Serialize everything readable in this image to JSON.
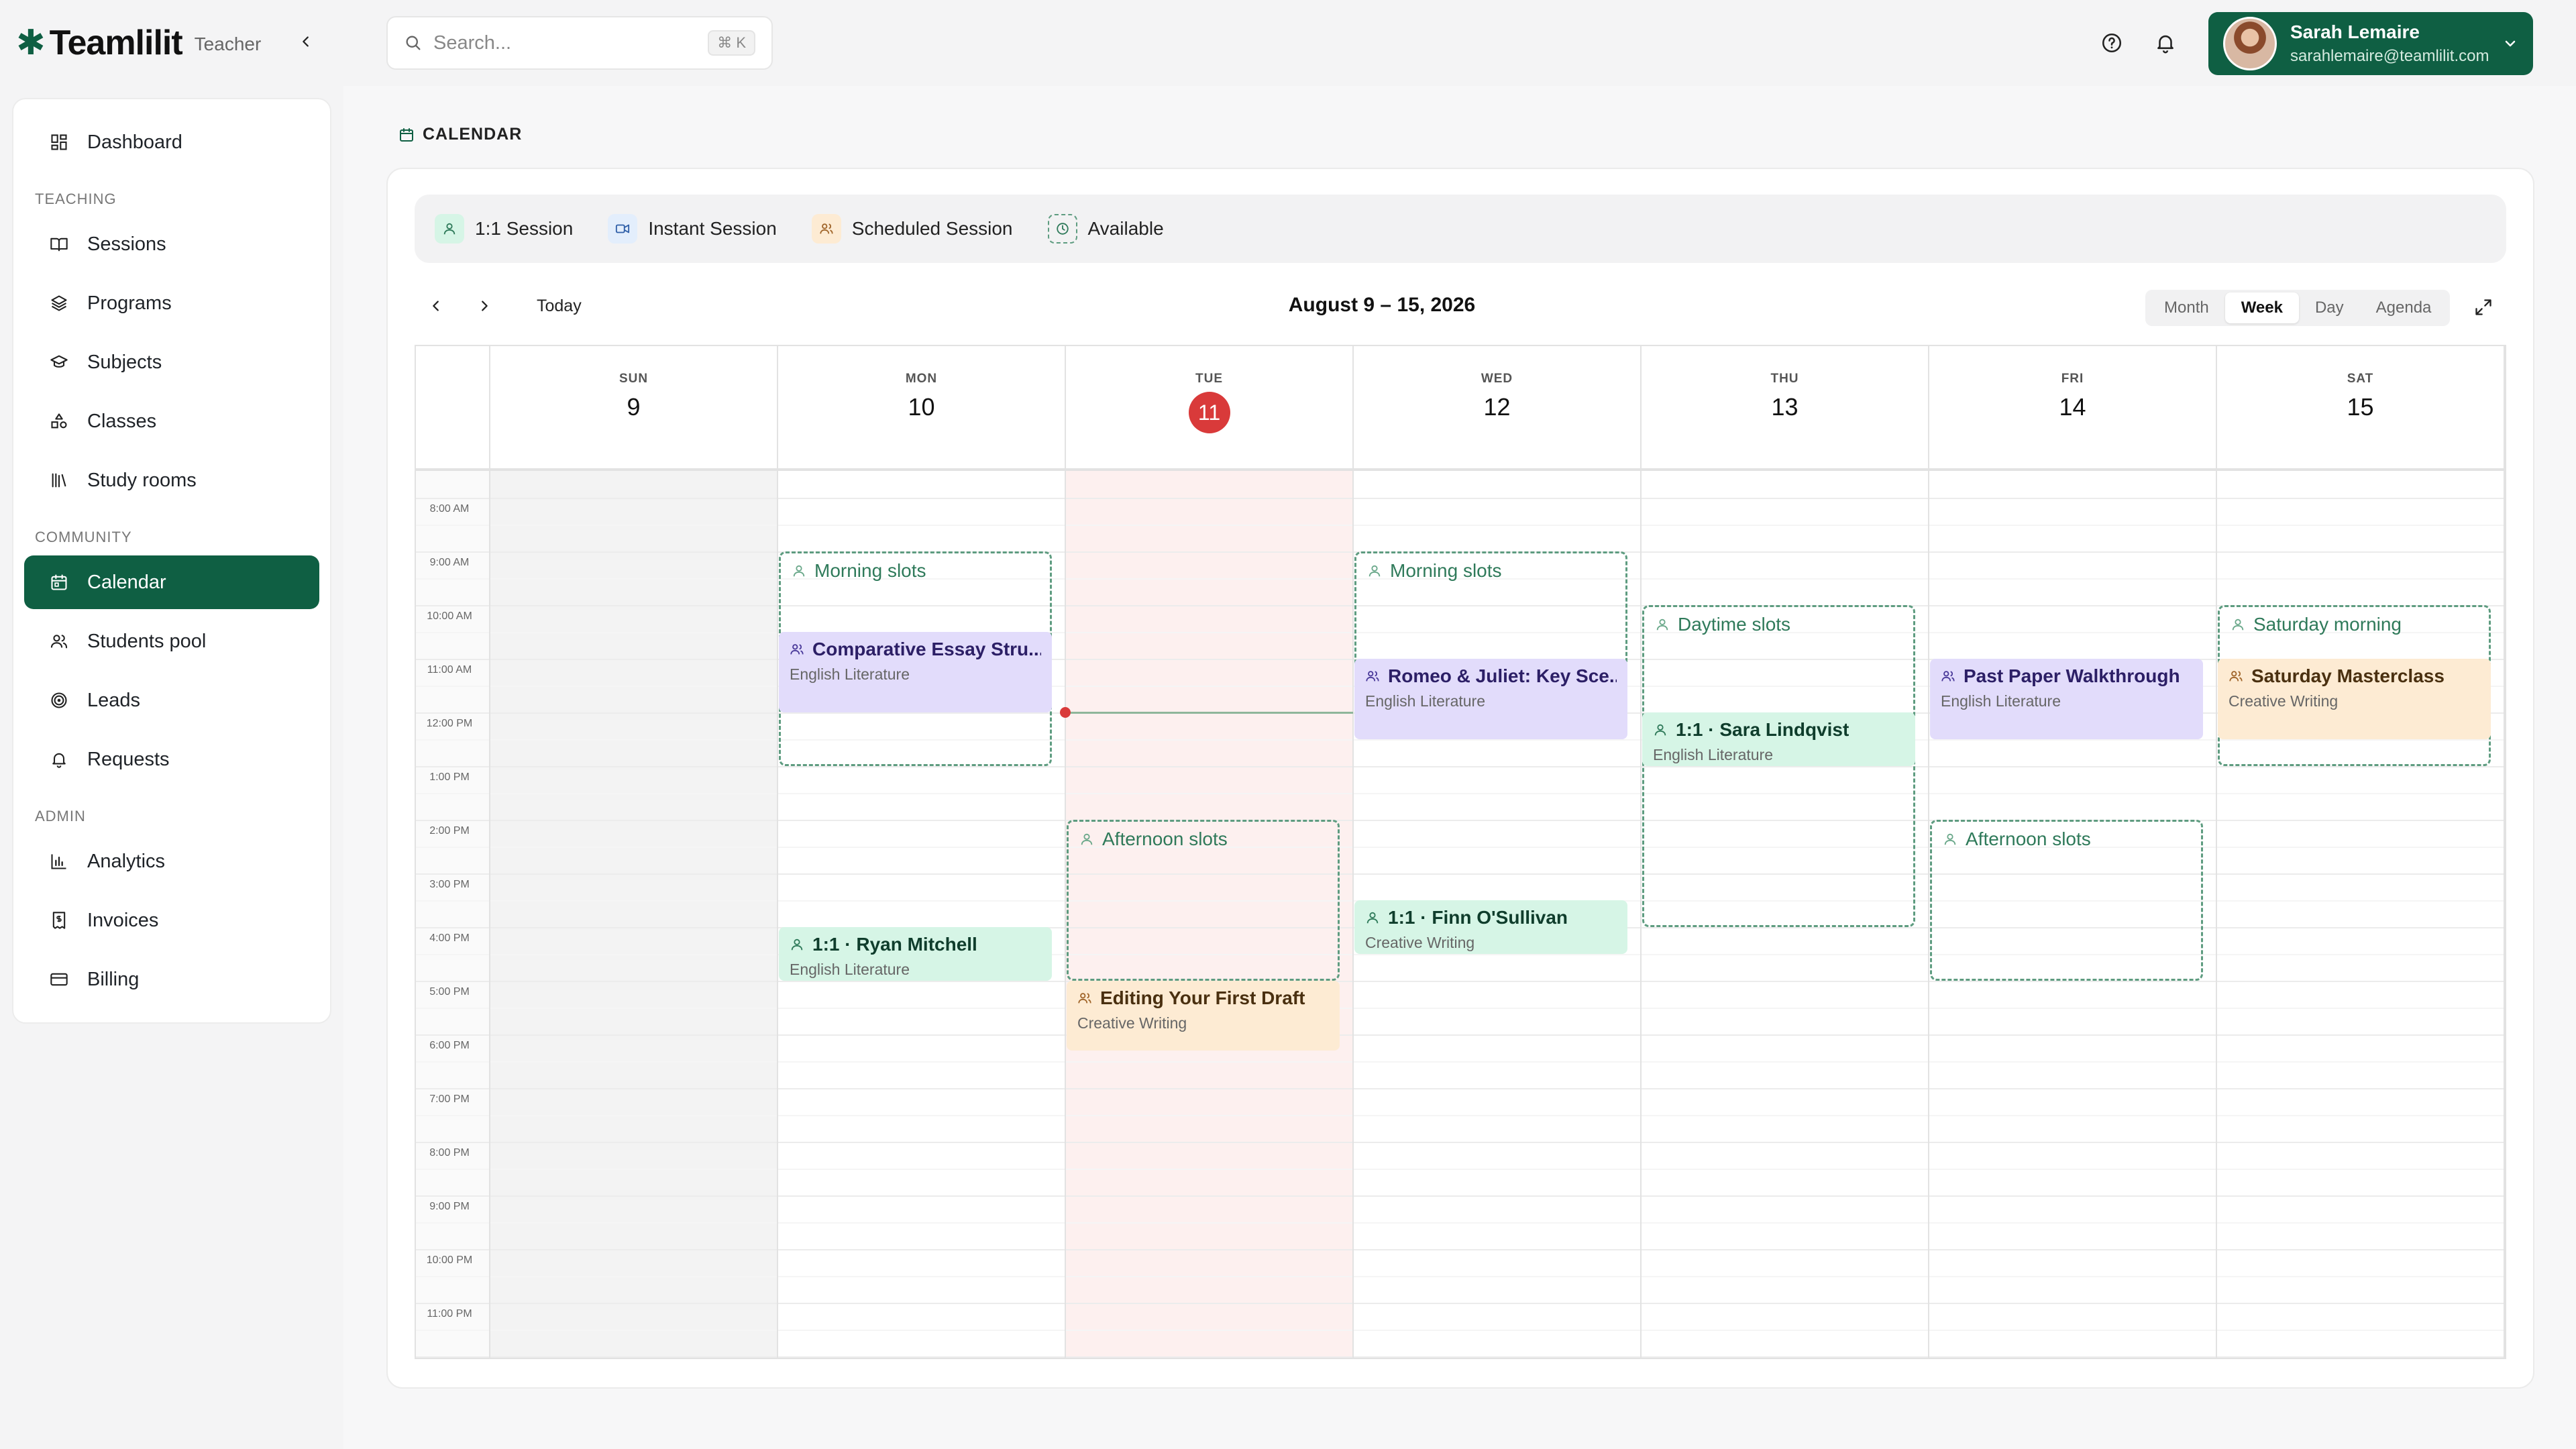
{
  "brand": {
    "name": "Teamlilit",
    "role": "Teacher"
  },
  "search": {
    "placeholder": "Search...",
    "shortcut": "⌘ K"
  },
  "user": {
    "name": "Sarah Lemaire",
    "email": "sarahlemaire@teamlilit.com"
  },
  "sidebar": {
    "dashboard": "Dashboard",
    "teaching_label": "TEACHING",
    "teaching": [
      "Sessions",
      "Programs",
      "Subjects",
      "Classes",
      "Study rooms"
    ],
    "community_label": "COMMUNITY",
    "community": [
      "Calendar",
      "Students pool",
      "Leads",
      "Requests"
    ],
    "admin_label": "ADMIN",
    "admin": [
      "Analytics",
      "Invoices",
      "Billing"
    ]
  },
  "page": {
    "title": "CALENDAR"
  },
  "legend": [
    "1:1 Session",
    "Instant Session",
    "Scheduled Session",
    "Available"
  ],
  "toolbar": {
    "today": "Today",
    "range": "August 9 – 15, 2026",
    "views": [
      "Month",
      "Week",
      "Day",
      "Agenda"
    ],
    "active_view": "Week"
  },
  "days": [
    {
      "name": "SUN",
      "num": "9"
    },
    {
      "name": "MON",
      "num": "10"
    },
    {
      "name": "TUE",
      "num": "11",
      "today": true
    },
    {
      "name": "WED",
      "num": "12"
    },
    {
      "name": "THU",
      "num": "13"
    },
    {
      "name": "FRI",
      "num": "14"
    },
    {
      "name": "SAT",
      "num": "15"
    }
  ],
  "times": [
    "8:00 AM",
    "9:00 AM",
    "10:00 AM",
    "11:00 AM",
    "12:00 PM",
    "1:00 PM",
    "2:00 PM",
    "3:00 PM",
    "4:00 PM",
    "5:00 PM",
    "6:00 PM",
    "7:00 PM",
    "8:00 PM",
    "9:00 PM",
    "10:00 PM",
    "11:00 PM"
  ],
  "slots": [
    {
      "day": 1,
      "start": 9,
      "end": 13,
      "label": "Morning slots"
    },
    {
      "day": 3,
      "start": 9,
      "end": 11.5,
      "label": "Morning slots"
    },
    {
      "day": 4,
      "start": 10,
      "end": 16,
      "label": "Daytime slots"
    },
    {
      "day": 6,
      "start": 10,
      "end": 13,
      "label": "Saturday morning"
    },
    {
      "day": 2,
      "start": 14,
      "end": 17,
      "label": "Afternoon slots"
    },
    {
      "day": 5,
      "start": 14,
      "end": 17,
      "label": "Afternoon slots"
    }
  ],
  "events": [
    {
      "day": 1,
      "start": 10.5,
      "end": 12,
      "title": "Comparative Essay Stru...",
      "subtitle": "English Literature",
      "kind": "scheduled",
      "color": "purple"
    },
    {
      "day": 3,
      "start": 11,
      "end": 12.5,
      "title": "Romeo & Juliet: Key Sce...",
      "subtitle": "English Literature",
      "kind": "scheduled",
      "color": "purple"
    },
    {
      "day": 5,
      "start": 11,
      "end": 12.5,
      "title": "Past Paper Walkthrough",
      "subtitle": "English Literature",
      "kind": "scheduled",
      "color": "purple"
    },
    {
      "day": 4,
      "start": 12,
      "end": 13,
      "title": "1:1 · Sara Lindqvist",
      "subtitle": "English Literature",
      "kind": "one",
      "color": "green"
    },
    {
      "day": 6,
      "start": 11,
      "end": 12.5,
      "title": "Saturday Masterclass",
      "subtitle": "Creative Writing",
      "kind": "scheduled",
      "color": "orange"
    },
    {
      "day": 3,
      "start": 15.5,
      "end": 16.5,
      "title": "1:1 · Finn O'Sullivan",
      "subtitle": "Creative Writing",
      "kind": "one",
      "color": "green"
    },
    {
      "day": 1,
      "start": 16,
      "end": 17,
      "title": "1:1 · Ryan Mitchell",
      "subtitle": "English Literature",
      "kind": "one",
      "color": "green"
    },
    {
      "day": 2,
      "start": 17,
      "end": 18.3,
      "title": "Editing Your First Draft",
      "subtitle": "Creative Writing",
      "kind": "scheduled",
      "color": "orange"
    }
  ],
  "now": {
    "day": 2,
    "hour": 12
  },
  "colors": {
    "brand": "#0f5f43",
    "today": "#d93a3a",
    "scheduled_purple": "#e2dcfb",
    "one_to_one_green": "#d6f5e6",
    "scheduled_orange": "#fdebd3",
    "available_border": "#5e9c80"
  }
}
